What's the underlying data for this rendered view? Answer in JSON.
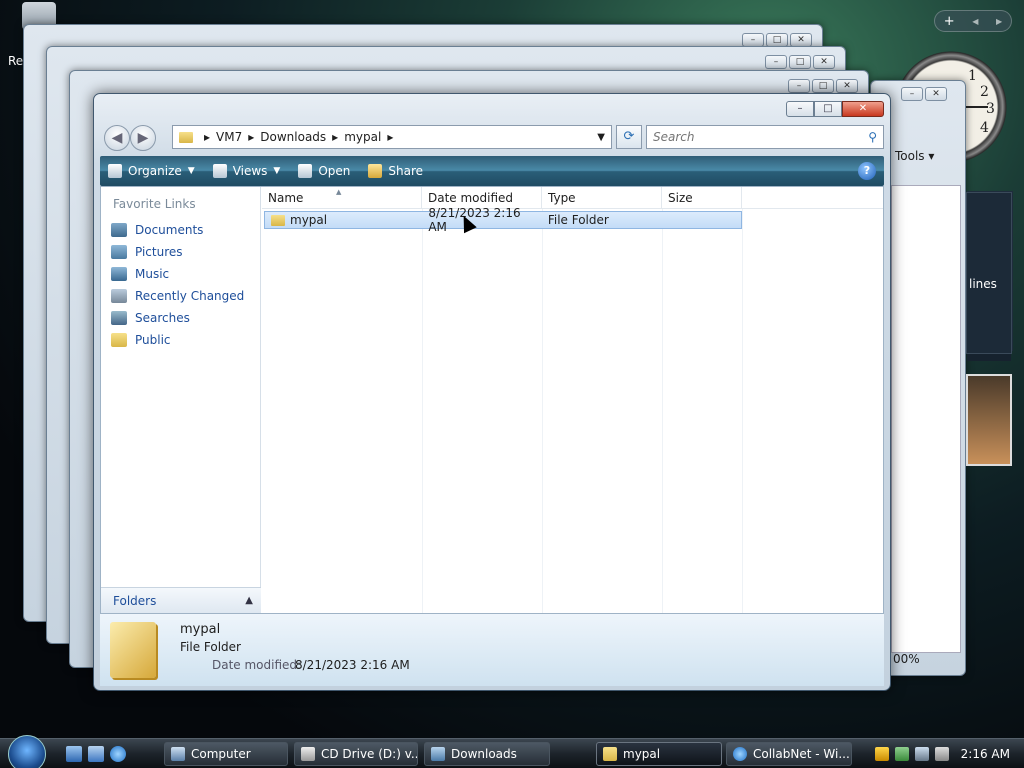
{
  "desktop": {
    "recycle_label": "Re",
    "gadget_plus": "+",
    "gadget_prev": "◀",
    "gadget_next": "▶",
    "clock_numbers": [
      "1",
      "2",
      "3",
      "4"
    ],
    "bg_tools": "Tools",
    "bg_lines": "lines",
    "bg_zoom": "00%"
  },
  "window": {
    "address": [
      "VM7",
      "Downloads",
      "mypal"
    ],
    "search_placeholder": "Search",
    "toolbar": {
      "organize": "Organize",
      "views": "Views",
      "open": "Open",
      "share": "Share",
      "help": "?"
    },
    "nav": {
      "header": "Favorite Links",
      "links": [
        "Documents",
        "Pictures",
        "Music",
        "Recently Changed",
        "Searches",
        "Public"
      ],
      "folders": "Folders"
    },
    "columns": [
      "Name",
      "Date modified",
      "Type",
      "Size"
    ],
    "files": [
      {
        "name": "mypal",
        "date": "8/21/2023 2:16 AM",
        "type": "File Folder",
        "size": ""
      }
    ],
    "details": {
      "name": "mypal",
      "type": "File Folder",
      "date_label": "Date modified:",
      "date_value": "8/21/2023 2:16 AM"
    }
  },
  "taskbar": {
    "tasks": [
      {
        "label": "Computer"
      },
      {
        "label": "CD Drive (D:) v..."
      },
      {
        "label": "Downloads"
      },
      {
        "label": "mypal"
      },
      {
        "label": "CollabNet - Wi..."
      }
    ],
    "time": "2:16 AM"
  },
  "colors": {
    "toolbar": "#2f5d76",
    "link": "#1e4e9a",
    "selection": "#c3dcf7"
  }
}
